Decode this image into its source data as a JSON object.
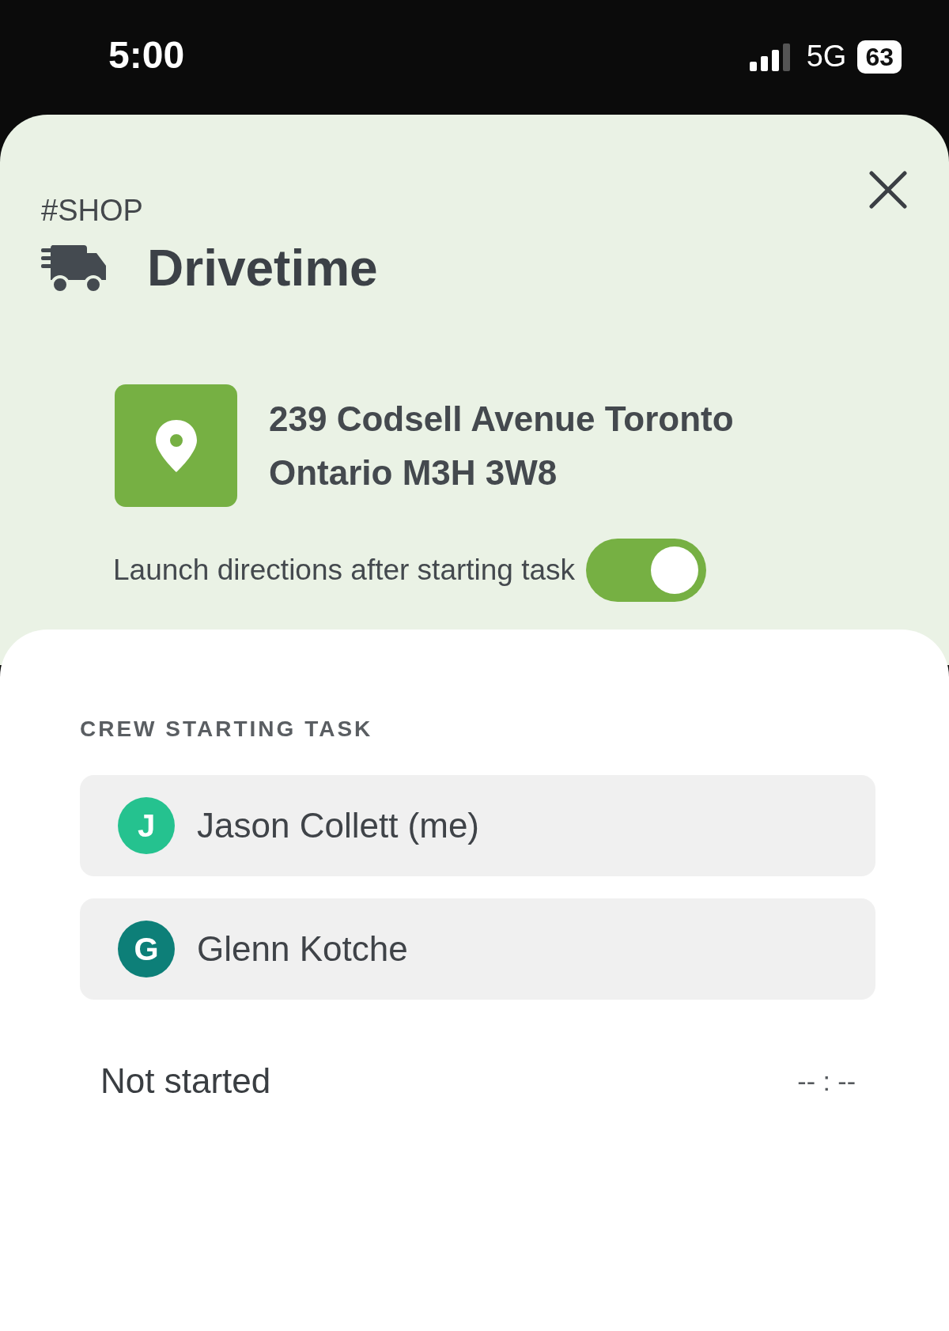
{
  "status_bar": {
    "time": "5:00",
    "network": "5G",
    "battery": "63"
  },
  "task": {
    "category": "#SHOP",
    "title": "Drivetime",
    "address_lines": [
      "239 Codsell Avenue Toronto",
      "Ontario M3H 3W8"
    ],
    "launch_directions": {
      "label": "Launch directions after starting task",
      "on": true
    }
  },
  "crew": {
    "heading": "CREW STARTING TASK",
    "members": [
      {
        "initial": "J",
        "name": "Jason Collett (me)",
        "color": "#25c28f"
      },
      {
        "initial": "G",
        "name": "Glenn Kotche",
        "color": "#0d7f78"
      }
    ]
  },
  "status": {
    "label": "Not started",
    "time": "-- : --"
  }
}
